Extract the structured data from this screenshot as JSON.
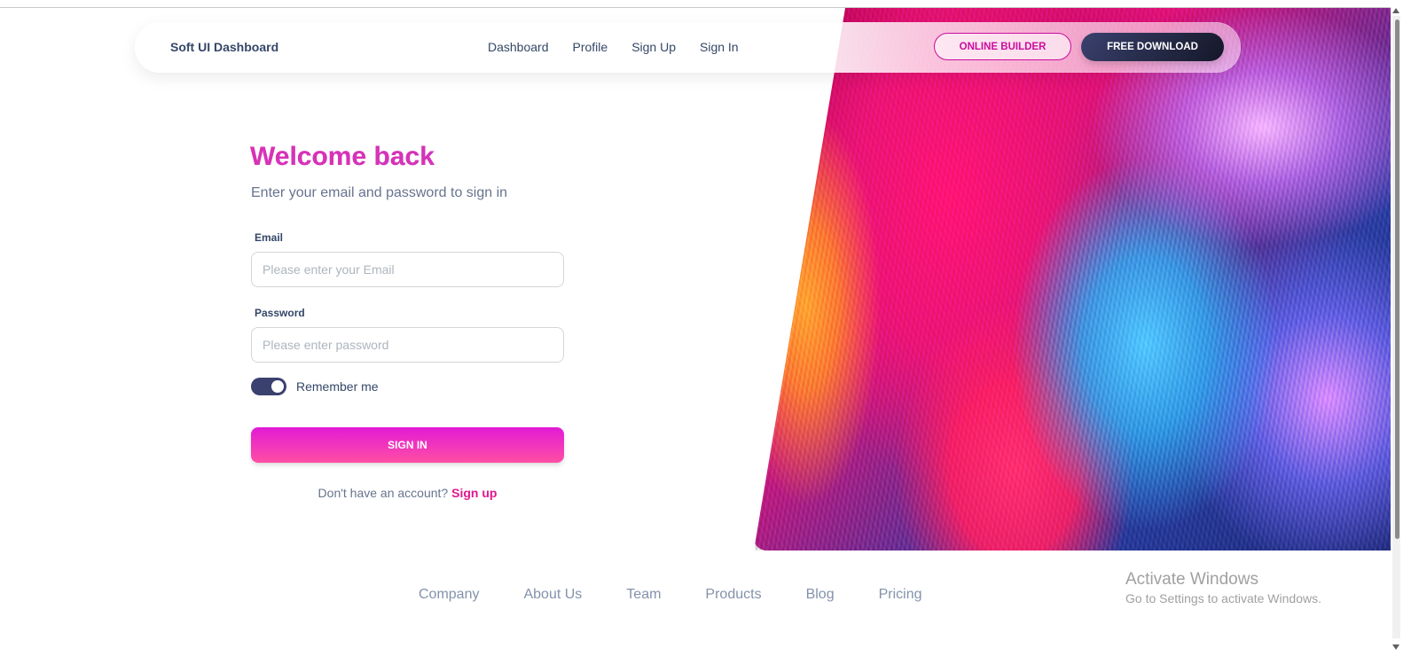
{
  "navbar": {
    "brand": "Soft UI Dashboard",
    "links": [
      "Dashboard",
      "Profile",
      "Sign Up",
      "Sign In"
    ],
    "online_builder_label": "ONLINE BUILDER",
    "free_download_label": "FREE DOWNLOAD"
  },
  "signin": {
    "title": "Welcome back",
    "subtitle": "Enter your email and password to sign in",
    "email_label": "Email",
    "email_placeholder": "Please enter your Email",
    "email_value": "",
    "password_label": "Password",
    "password_placeholder": "Please enter password",
    "password_value": "",
    "remember_label": "Remember me",
    "remember_checked": true,
    "submit_label": "SIGN IN",
    "no_account_text": "Don't have an account?",
    "signup_link_label": "Sign up"
  },
  "footer": {
    "links": [
      "Company",
      "About Us",
      "Team",
      "Products",
      "Blog",
      "Pricing"
    ]
  },
  "watermark": {
    "title": "Activate Windows",
    "subtitle": "Go to Settings to activate Windows."
  },
  "colors": {
    "accent_pink": "#cb0c9f",
    "dark": "#141727",
    "text_primary": "#344767",
    "text_secondary": "#67748e"
  }
}
